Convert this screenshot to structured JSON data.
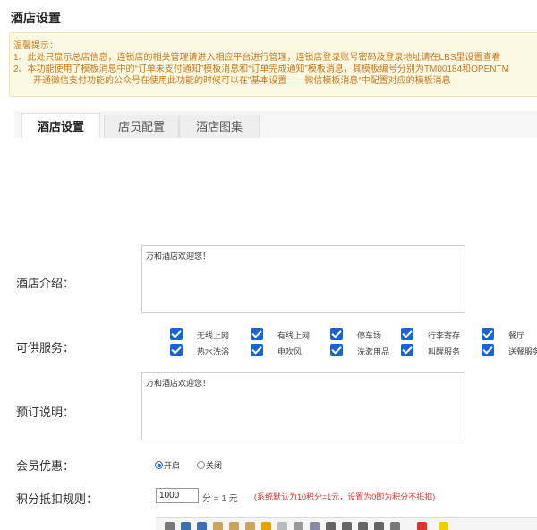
{
  "page": {
    "title": "酒店设置"
  },
  "notice": {
    "heading": "温馨提示：",
    "line1": "1、此处只显示总店信息，连锁店的相关管理请进入相应平台进行管理，连锁店登录账号密码及登录地址请在LBS里设置查看",
    "line2": "2、本功能使用了模板消息中的“订单未支付通知”模板消息和“订单完成通知”模板消息，其模板编号分别为TM00184和OPENTM",
    "line3": "开通微信支付功能的公众号在使用此功能的时候可以在”基本设置——微信模板消息“中配置对应的模板消息"
  },
  "tabs": [
    {
      "label": "酒店设置",
      "active": true
    },
    {
      "label": "店员配置",
      "active": false
    },
    {
      "label": "酒店图集",
      "active": false
    }
  ],
  "form": {
    "intro": {
      "label": "酒店介绍：",
      "value": "万和酒店欢迎您！"
    },
    "services": {
      "label": "可供服务：",
      "items": [
        {
          "label": "无线上网",
          "checked": true
        },
        {
          "label": "有线上网",
          "checked": true
        },
        {
          "label": "停车场",
          "checked": true
        },
        {
          "label": "行李寄存",
          "checked": true
        },
        {
          "label": "餐厅",
          "checked": true
        },
        {
          "label": "热水洗浴",
          "checked": true
        },
        {
          "label": "电吹风",
          "checked": true
        },
        {
          "label": "洗漱用品",
          "checked": true
        },
        {
          "label": "叫醒服务",
          "checked": true
        },
        {
          "label": "送餐服务",
          "checked": true
        }
      ]
    },
    "booking_note": {
      "label": "预订说明：",
      "value": "万和酒店欢迎您！"
    },
    "member_discount": {
      "label": "会员优惠：",
      "options": [
        "开启",
        "关闭"
      ],
      "selected": "开启"
    },
    "points_rule": {
      "label": "积分抵扣规则：",
      "value": "1000",
      "unit_text": "分 = 1 元",
      "hint": "(系统默认为10积分=1元，设置为0即为积分不抵扣)"
    }
  },
  "colors": {
    "accent": "#1a63d6",
    "notice_text": "#c87a1a",
    "hint_red": "#e12d2d"
  },
  "toolbar_icons": [
    "format-icon",
    "undo-icon",
    "redo-icon",
    "paste-icon",
    "paste-text-icon",
    "paste-word-icon",
    "brush-icon",
    "clear-format-icon",
    "clear-icon",
    "table-icon",
    "superscript-icon",
    "font-size-up-icon",
    "font-size-down-icon",
    "subscript-icon",
    "align-icon",
    "font-color-icon",
    "highlight-icon"
  ]
}
